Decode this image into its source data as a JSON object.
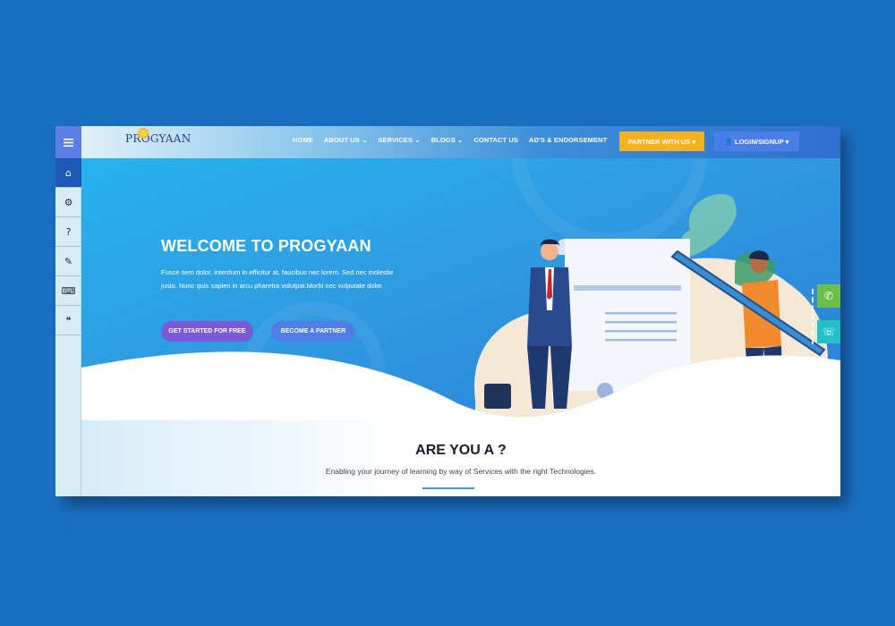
{
  "brand": {
    "logo_text": "PROGYAAN"
  },
  "nav": {
    "items": [
      "HOME",
      "ABOUT US",
      "SERVICES",
      "BLOGS",
      "CONTACT US",
      "AD'S & ENDORSEMENT"
    ],
    "partner_button": "PARTNER WITH US",
    "login_button": "LOGIN/SIGNUP"
  },
  "sidebar": {
    "items": [
      {
        "icon": "home-icon",
        "glyph": "⌂"
      },
      {
        "icon": "gears-icon",
        "glyph": "⚙"
      },
      {
        "icon": "question-icon",
        "glyph": "?"
      },
      {
        "icon": "tools-icon",
        "glyph": "✎"
      },
      {
        "icon": "keyboard-icon",
        "glyph": "⌨"
      },
      {
        "icon": "quote-icon",
        "glyph": "❝"
      }
    ]
  },
  "hero": {
    "title": "WELCOME TO PROGYAAN",
    "text": "Fusce sem dolor, interdum in efficitur at, faucibus nec lorem. Sed nec molestie justo. Nunc quis sapien in arcu pharetra volutpat.Morbi nec vulputate dolor.",
    "btn_start": "GET STARTED FOR FREE",
    "btn_partner": "BECOME A PARTNER"
  },
  "section": {
    "title": "ARE YOU A ?",
    "subtitle": "Enabling your journey of learning by way of Services with the right Technologies."
  },
  "colors": {
    "page_bg": "#1a6fc2",
    "accent_yellow": "#f5b21c",
    "accent_blue": "#4a7ee8",
    "accent_purple": "#7a5ad9",
    "whatsapp_green": "#6cc04a",
    "phone_teal": "#21c1c8"
  }
}
